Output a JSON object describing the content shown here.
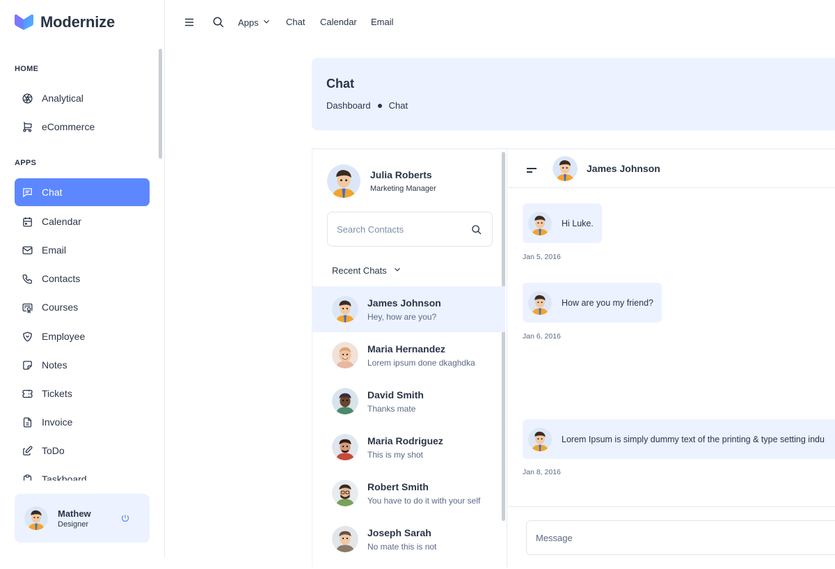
{
  "brand": {
    "name": "Modernize"
  },
  "sidebar": {
    "sections": [
      {
        "title": "HOME"
      },
      {
        "title": "APPS"
      }
    ],
    "items": [
      {
        "label": "Analytical",
        "icon": "aperture-icon"
      },
      {
        "label": "eCommerce",
        "icon": "cart-icon"
      },
      {
        "label": "Chat",
        "icon": "message-icon",
        "active": true
      },
      {
        "label": "Calendar",
        "icon": "calendar-icon"
      },
      {
        "label": "Email",
        "icon": "mail-icon"
      },
      {
        "label": "Contacts",
        "icon": "phone-icon"
      },
      {
        "label": "Courses",
        "icon": "certificate-icon"
      },
      {
        "label": "Employee",
        "icon": "shield-icon"
      },
      {
        "label": "Notes",
        "icon": "note-icon"
      },
      {
        "label": "Tickets",
        "icon": "ticket-icon"
      },
      {
        "label": "Invoice",
        "icon": "invoice-icon"
      },
      {
        "label": "ToDo",
        "icon": "edit-icon"
      },
      {
        "label": "Taskboard",
        "icon": "clipboard-icon"
      }
    ],
    "profile": {
      "name": "Mathew",
      "role": "Designer"
    }
  },
  "topbar": {
    "links": [
      "Apps",
      "Chat",
      "Calendar",
      "Email"
    ]
  },
  "banner": {
    "title": "Chat",
    "breadcrumb": [
      "Dashboard",
      "Chat"
    ]
  },
  "chat": {
    "me": {
      "name": "Julia Roberts",
      "role": "Marketing Manager"
    },
    "search_placeholder": "Search Contacts",
    "recent_label": "Recent Chats",
    "contacts": [
      {
        "name": "James Johnson",
        "last": "Hey, how are you?",
        "active": true
      },
      {
        "name": "Maria Hernandez",
        "last": "Lorem ipsum done dkaghdka"
      },
      {
        "name": "David Smith",
        "last": "Thanks mate"
      },
      {
        "name": "Maria Rodriguez",
        "last": "This is my shot"
      },
      {
        "name": "Robert Smith",
        "last": "You have to do it with your self"
      },
      {
        "name": "Joseph Sarah",
        "last": "No mate this is not"
      }
    ],
    "conversation": {
      "with": "James Johnson",
      "messages": [
        {
          "text": "Hi Luke.",
          "date": "Jan 5, 2016"
        },
        {
          "text": "How are you my friend?",
          "date": "Jan 6, 2016"
        },
        {
          "text": "Lorem Ipsum is simply dummy text of the printing & type setting indu",
          "date": "Jan 8, 2016"
        }
      ],
      "input_placeholder": "Message"
    }
  },
  "colors": {
    "primary": "#5d87ff",
    "light_primary": "#ecf2ff",
    "text": "#2a3547"
  }
}
